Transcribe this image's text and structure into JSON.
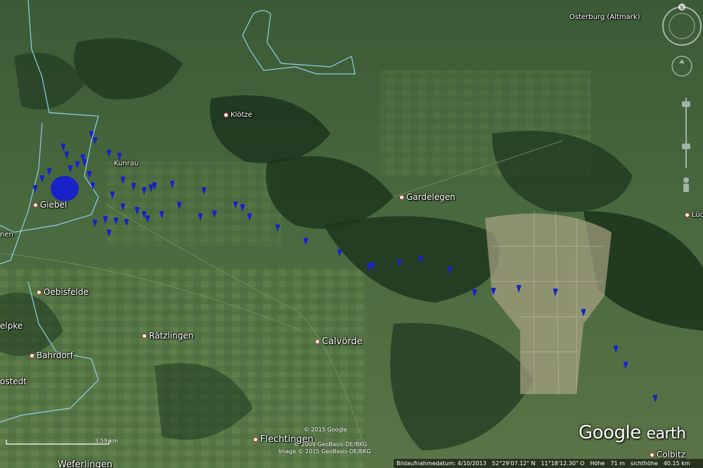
{
  "places": [
    {
      "id": "osterburg",
      "label": "Osterburg (Altmark)",
      "size": "small"
    },
    {
      "id": "klotze",
      "label": "Klötze",
      "size": "small"
    },
    {
      "id": "kunrau",
      "label": "Kunrau",
      "size": "small"
    },
    {
      "id": "giebel",
      "label": "Giebel",
      "size": "mid"
    },
    {
      "id": "gardelegen",
      "label": "Gardelegen",
      "size": "mid"
    },
    {
      "id": "lud",
      "label": "Lüd",
      "size": "small"
    },
    {
      "id": "nen",
      "label": "nen",
      "size": "small"
    },
    {
      "id": "oebisfelde",
      "label": "Oebisfelde",
      "size": "mid"
    },
    {
      "id": "elpke",
      "label": "elpke",
      "size": "mid"
    },
    {
      "id": "raetzlingen",
      "label": "Rätzlingen",
      "size": "mid"
    },
    {
      "id": "calvoerde",
      "label": "Calvörde",
      "size": "big"
    },
    {
      "id": "bahrdorf",
      "label": "Bahrdorf",
      "size": "mid"
    },
    {
      "id": "ostedt",
      "label": "ostedt",
      "size": "mid"
    },
    {
      "id": "flechtingen",
      "label": "Flechtingen",
      "size": "big"
    },
    {
      "id": "weferlingen",
      "label": "Weferlingen",
      "size": "big"
    },
    {
      "id": "colbitz",
      "label": "Colbitz",
      "size": "mid"
    }
  ],
  "copyright": {
    "line1": "© 2015 Google",
    "line2": "© 2009 GeoBasis-DE/BKG",
    "line3": "Image © 2015 GeoBasis-DE/BKG"
  },
  "status_bar": {
    "date": "Bildaufnahmedatum: 4/10/2013",
    "lat": "52°29'07.12\" N",
    "lon": "11°18'12.30\" O",
    "elev_label": "Höhe",
    "elev": "71 m",
    "eye_label": "sichthöhe",
    "eye": "40.15 km"
  },
  "logo": {
    "google": "Google",
    "earth": "earth"
  },
  "scale": {
    "label": "3.59 km"
  },
  "compass": {
    "north": "N"
  },
  "colors": {
    "marker": "#1822c8",
    "border": "#8fd0e8",
    "status_bg": "#000000"
  }
}
